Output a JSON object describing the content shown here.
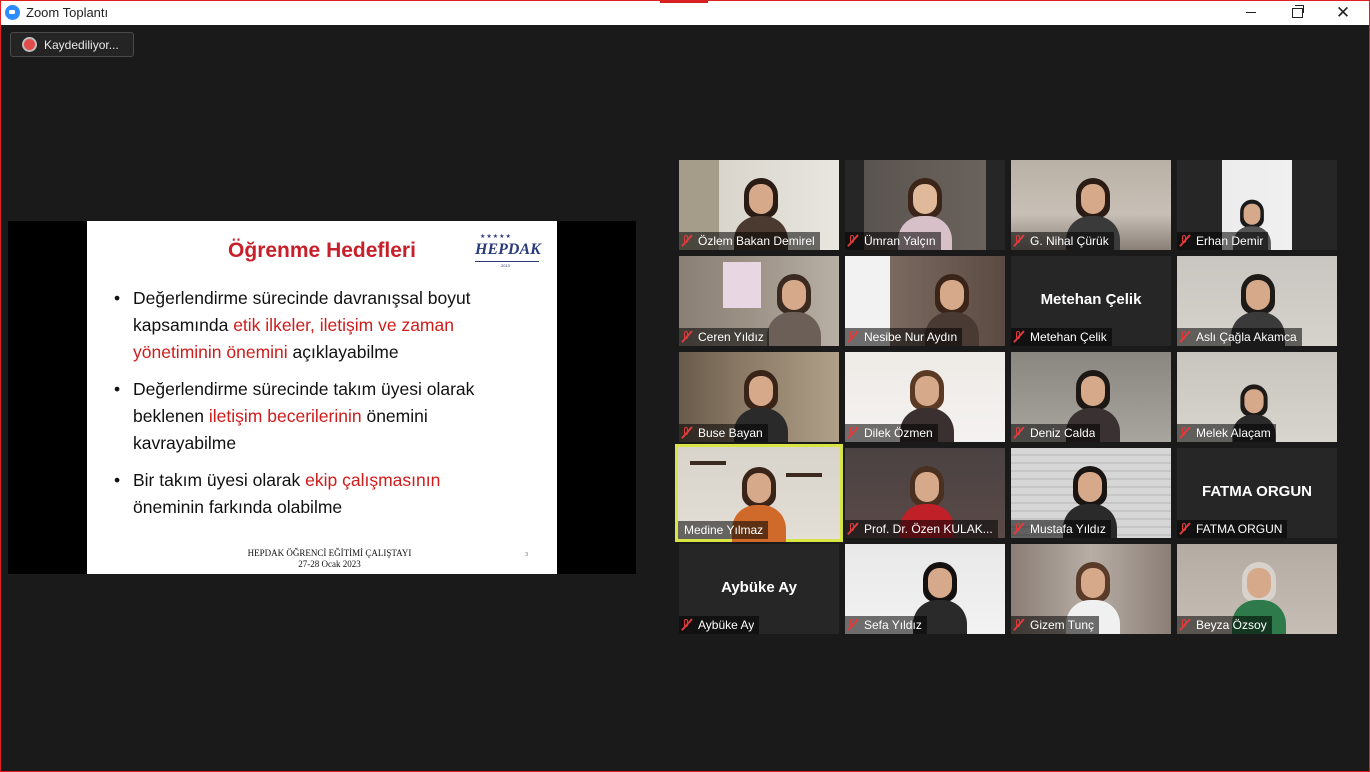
{
  "window": {
    "title": "Zoom Toplantı"
  },
  "recording": {
    "label": "Kaydediliyor..."
  },
  "slide": {
    "title": "Öğrenme Hedefleri",
    "logo_text": "HEPDAK",
    "logo_year": "2013",
    "bullets": [
      {
        "l1": "Değerlendirme sürecinde davranışsal boyut",
        "l2a": "kapsamında ",
        "l2b": " etik ilkeler, iletişim ve zaman",
        "l3a": "yönetiminin önemini",
        "l3b": " açıklayabilme"
      },
      {
        "l1": "Değerlendirme sürecinde takım üyesi olarak",
        "l2a": "beklenen ",
        "l2b": "iletişim becerilerinin",
        "l2c": " önemini",
        "l3": "kavrayabilme"
      },
      {
        "l1a": "Bir takım üyesi olarak ",
        "l1b": "ekip çalışmasının",
        "l2": "öneminin farkında olabilme"
      }
    ],
    "footer_line1": "HEPDAK ÖĞRENCİ EĞİTİMİ ÇALIŞTAYI",
    "footer_line2": "27-28 Ocak 2023",
    "page_number": "3"
  },
  "participants": [
    {
      "name": "Özlem Bakan Demirel",
      "muted": true
    },
    {
      "name": "Ümran Yalçın",
      "muted": true
    },
    {
      "name": "G. Nihal Çürük",
      "muted": true
    },
    {
      "name": "Erhan Demir",
      "muted": true
    },
    {
      "name": "Ceren Yıldız",
      "muted": true
    },
    {
      "name": "Nesibe Nur Aydın",
      "muted": true
    },
    {
      "name": "Metehan Çelik",
      "muted": true,
      "video_off": true
    },
    {
      "name": "Aslı Çağla Akamca",
      "muted": true
    },
    {
      "name": "Buse Bayan",
      "muted": true
    },
    {
      "name": "Dilek Özmen",
      "muted": true
    },
    {
      "name": "Deniz Calda",
      "muted": true
    },
    {
      "name": "Melek Alaçam",
      "muted": true
    },
    {
      "name": "Medine Yılmaz",
      "muted": false,
      "active_speaker": true
    },
    {
      "name": "Prof. Dr. Özen KULAK...",
      "muted": true
    },
    {
      "name": "Mustafa Yıldız",
      "muted": true
    },
    {
      "name": "FATMA ORGUN",
      "muted": true,
      "video_off": true
    },
    {
      "name": "Aybüke Ay",
      "muted": true,
      "video_off": true
    },
    {
      "name": "Sefa Yıldız",
      "muted": true
    },
    {
      "name": "Gizem Tunç",
      "muted": true
    },
    {
      "name": "Beyza Özsoy",
      "muted": true
    }
  ]
}
